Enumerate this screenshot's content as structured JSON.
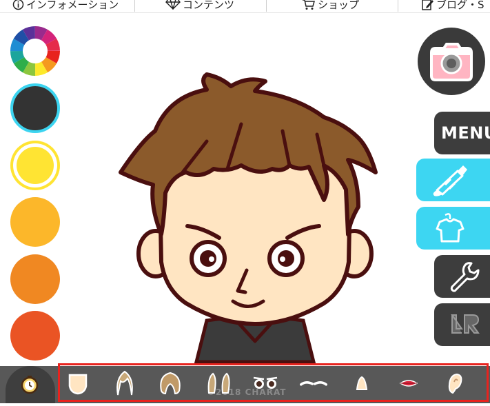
{
  "nav": {
    "items": [
      {
        "label": "インフォメーション",
        "icon": "info-icon"
      },
      {
        "label": "コンテンツ",
        "icon": "diamond-icon"
      },
      {
        "label": "ショップ",
        "icon": "cart-icon"
      },
      {
        "label": "ブログ・S",
        "icon": "edit-icon"
      }
    ]
  },
  "palette": {
    "colors": [
      "#333333",
      "#ffe433",
      "#fcb72a",
      "#f08822",
      "#ea5424"
    ],
    "wheel_icon": "color-wheel-icon"
  },
  "right_panel": {
    "menu_label": "MENU",
    "camera_icon": "camera-icon",
    "paint_icon": "paint-tube-icon",
    "clothes_icon": "shirt-icon",
    "settings_icon": "wrench-icon",
    "lr_icon": "lr-icon"
  },
  "bottom": {
    "home_icon": "clock-icon",
    "watermark": "©2018 CHARAT",
    "parts": [
      "face-icon",
      "front-hair-icon",
      "back-hair-icon",
      "side-hair-icon",
      "eyes-icon",
      "eyebrows-icon",
      "nose-icon",
      "mouth-icon",
      "ear-icon"
    ]
  },
  "colors": {
    "accent_cyan": "#3dd6f2",
    "dark": "#3d3d3d",
    "highlight": "#e8231e",
    "hair": "#8b5a2b",
    "skin": "#ffe5c2",
    "outline": "#4a0f0f"
  }
}
